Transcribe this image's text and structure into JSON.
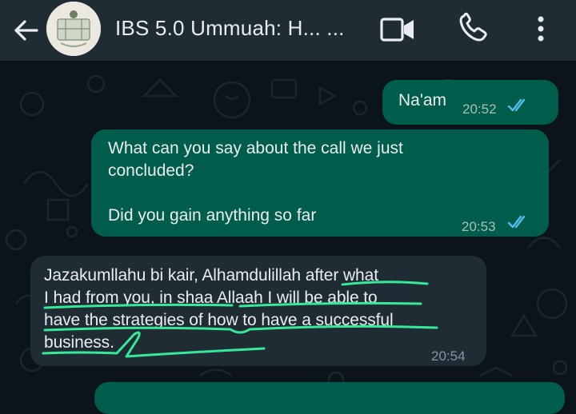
{
  "header": {
    "chat_title": "IBS 5.0 Ummuah: H... ...",
    "back_icon": "arrow-back-icon",
    "video_icon": "video-call-icon",
    "call_icon": "phone-icon",
    "menu_icon": "more-vert-icon"
  },
  "messages": [
    {
      "direction": "outgoing",
      "text": "Na'am",
      "time": "20:52",
      "status": "read"
    },
    {
      "direction": "outgoing",
      "text": "What can you say about the call we just\nconcluded?\n\nDid you gain anything so far",
      "time": "20:53",
      "status": "read"
    },
    {
      "direction": "incoming",
      "text": "Jazakumllahu bi kair, Alhamdulillah after what\nI had from you, in shaa Allaah I will be able to\nhave the strategies of how to have a successful\nbusiness.",
      "time": "20:54"
    }
  ],
  "colors": {
    "background": "#0b141a",
    "header": "#1f2c34",
    "outgoing_bubble": "#005c4b",
    "incoming_bubble": "#1f2c34",
    "read_ticks": "#53bdeb",
    "highlight_scribble": "#38e89a"
  }
}
